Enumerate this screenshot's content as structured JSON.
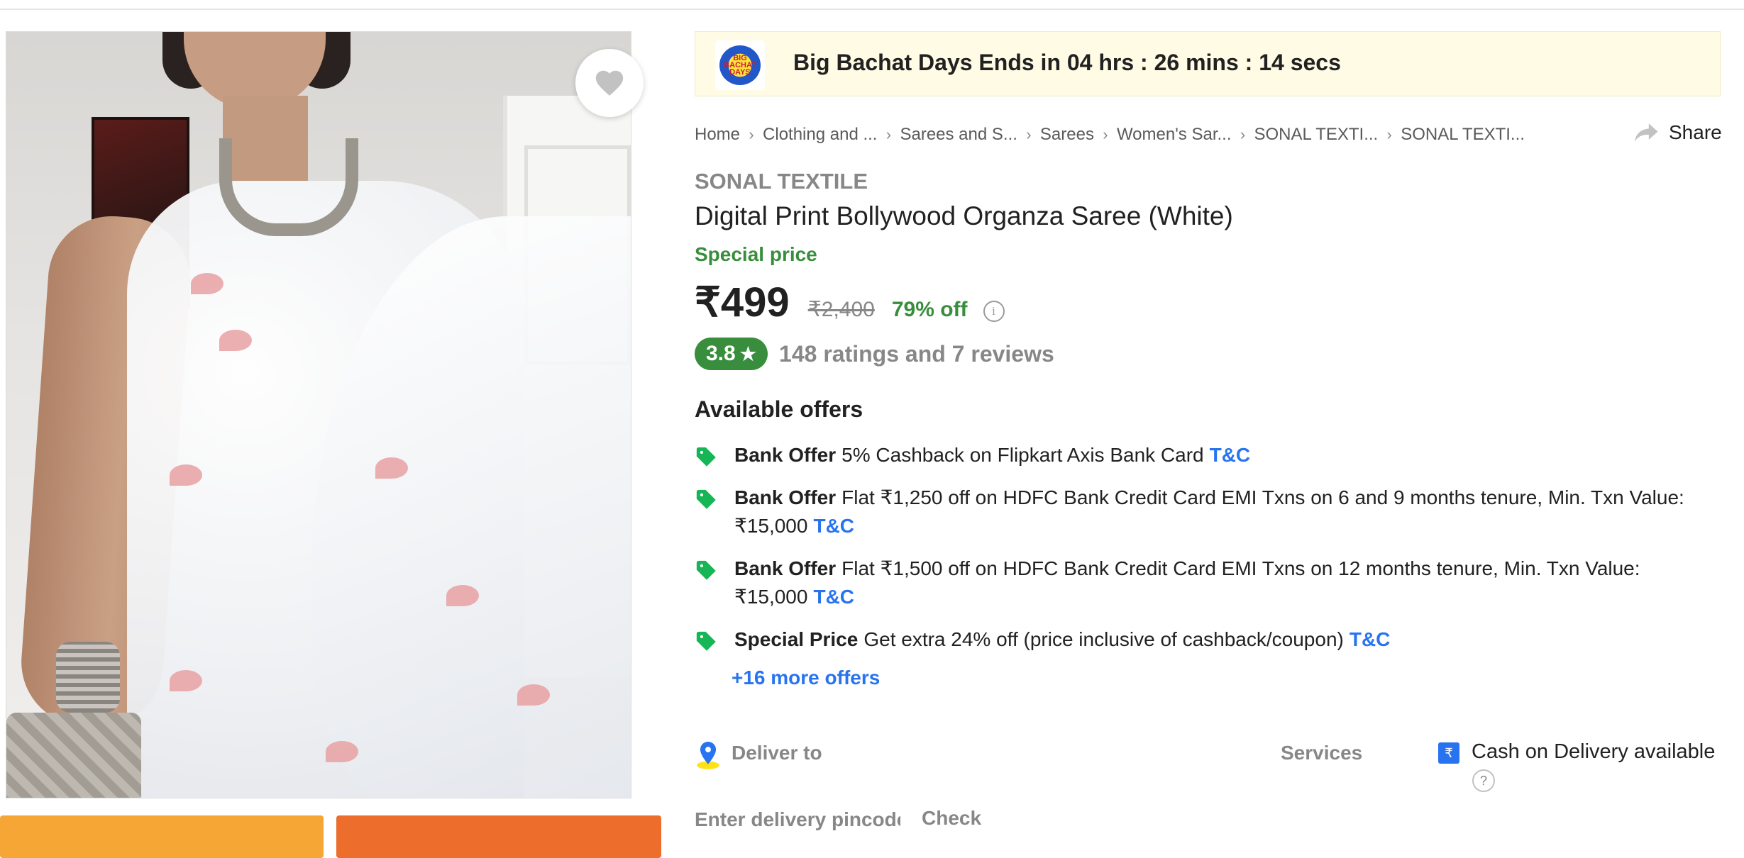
{
  "promo": {
    "logo_text": "BIG BACHAT DAYS",
    "text": "Big Bachat Days Ends in 04 hrs : 26 mins : 14 secs"
  },
  "breadcrumb": [
    "Home",
    "Clothing and ...",
    "Sarees and S...",
    "Sarees",
    "Women's Sar...",
    "SONAL TEXTI...",
    "SONAL TEXTI..."
  ],
  "share_label": "Share",
  "product": {
    "brand": "SONAL TEXTILE",
    "title": "Digital Print Bollywood Organza Saree  (White)",
    "special_label": "Special price",
    "price": "₹499",
    "mrp": "₹2,400",
    "discount": "79% off",
    "rating": "3.8",
    "rating_text": "148 ratings and 7 reviews"
  },
  "offers_heading": "Available offers",
  "offers": [
    {
      "title": "Bank Offer",
      "text": "5% Cashback on Flipkart Axis Bank Card",
      "tc": "T&C"
    },
    {
      "title": "Bank Offer",
      "text": "Flat ₹1,250 off on HDFC Bank Credit Card EMI Txns on 6 and 9 months tenure, Min. Txn Value: ₹15,000",
      "tc": "T&C"
    },
    {
      "title": "Bank Offer",
      "text": "Flat ₹1,500 off on HDFC Bank Credit Card EMI Txns on 12 months tenure, Min. Txn Value: ₹15,000",
      "tc": "T&C"
    },
    {
      "title": "Special Price",
      "text": "Get extra 24% off (price inclusive of cashback/coupon)",
      "tc": "T&C"
    }
  ],
  "more_offers": "+16 more offers",
  "delivery": {
    "label": "Deliver to",
    "placeholder": "Enter delivery pincode",
    "check": "Check"
  },
  "services": {
    "label": "Services",
    "cod_icon": "₹",
    "cod": "Cash on Delivery available",
    "help": "?"
  },
  "colors": {
    "green": "#388e3c",
    "blue": "#2874f0",
    "grey_text": "#878787",
    "promo_bg": "#fffbe4",
    "add_to_cart": "#f6a634",
    "buy_now": "#ec6d2c"
  }
}
